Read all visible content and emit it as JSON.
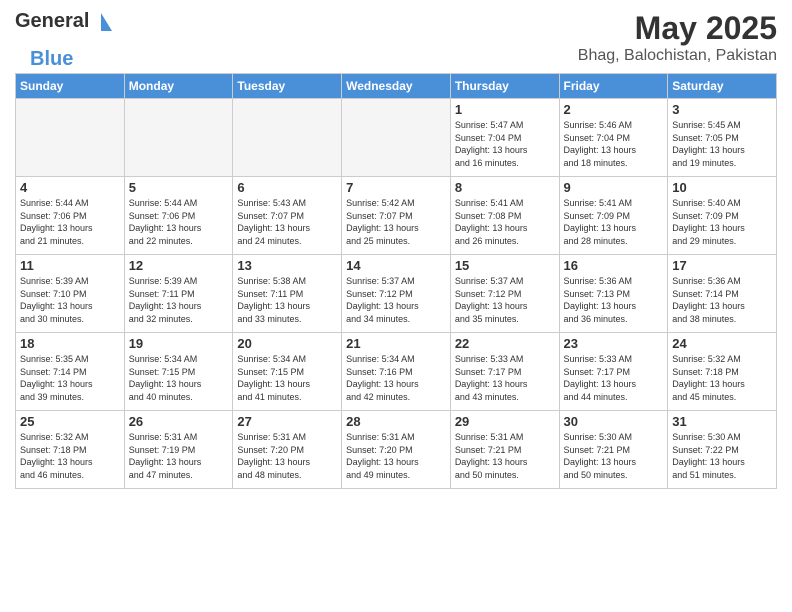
{
  "header": {
    "logo_text_general": "General",
    "logo_text_blue": "Blue",
    "title": "May 2025",
    "subtitle": "Bhag, Balochistan, Pakistan"
  },
  "calendar": {
    "days_of_week": [
      "Sunday",
      "Monday",
      "Tuesday",
      "Wednesday",
      "Thursday",
      "Friday",
      "Saturday"
    ],
    "weeks": [
      [
        {
          "num": "",
          "info": "",
          "empty": true
        },
        {
          "num": "",
          "info": "",
          "empty": true
        },
        {
          "num": "",
          "info": "",
          "empty": true
        },
        {
          "num": "",
          "info": "",
          "empty": true
        },
        {
          "num": "1",
          "info": "Sunrise: 5:47 AM\nSunset: 7:04 PM\nDaylight: 13 hours\nand 16 minutes.",
          "empty": false
        },
        {
          "num": "2",
          "info": "Sunrise: 5:46 AM\nSunset: 7:04 PM\nDaylight: 13 hours\nand 18 minutes.",
          "empty": false
        },
        {
          "num": "3",
          "info": "Sunrise: 5:45 AM\nSunset: 7:05 PM\nDaylight: 13 hours\nand 19 minutes.",
          "empty": false
        }
      ],
      [
        {
          "num": "4",
          "info": "Sunrise: 5:44 AM\nSunset: 7:06 PM\nDaylight: 13 hours\nand 21 minutes.",
          "empty": false
        },
        {
          "num": "5",
          "info": "Sunrise: 5:44 AM\nSunset: 7:06 PM\nDaylight: 13 hours\nand 22 minutes.",
          "empty": false
        },
        {
          "num": "6",
          "info": "Sunrise: 5:43 AM\nSunset: 7:07 PM\nDaylight: 13 hours\nand 24 minutes.",
          "empty": false
        },
        {
          "num": "7",
          "info": "Sunrise: 5:42 AM\nSunset: 7:07 PM\nDaylight: 13 hours\nand 25 minutes.",
          "empty": false
        },
        {
          "num": "8",
          "info": "Sunrise: 5:41 AM\nSunset: 7:08 PM\nDaylight: 13 hours\nand 26 minutes.",
          "empty": false
        },
        {
          "num": "9",
          "info": "Sunrise: 5:41 AM\nSunset: 7:09 PM\nDaylight: 13 hours\nand 28 minutes.",
          "empty": false
        },
        {
          "num": "10",
          "info": "Sunrise: 5:40 AM\nSunset: 7:09 PM\nDaylight: 13 hours\nand 29 minutes.",
          "empty": false
        }
      ],
      [
        {
          "num": "11",
          "info": "Sunrise: 5:39 AM\nSunset: 7:10 PM\nDaylight: 13 hours\nand 30 minutes.",
          "empty": false
        },
        {
          "num": "12",
          "info": "Sunrise: 5:39 AM\nSunset: 7:11 PM\nDaylight: 13 hours\nand 32 minutes.",
          "empty": false
        },
        {
          "num": "13",
          "info": "Sunrise: 5:38 AM\nSunset: 7:11 PM\nDaylight: 13 hours\nand 33 minutes.",
          "empty": false
        },
        {
          "num": "14",
          "info": "Sunrise: 5:37 AM\nSunset: 7:12 PM\nDaylight: 13 hours\nand 34 minutes.",
          "empty": false
        },
        {
          "num": "15",
          "info": "Sunrise: 5:37 AM\nSunset: 7:12 PM\nDaylight: 13 hours\nand 35 minutes.",
          "empty": false
        },
        {
          "num": "16",
          "info": "Sunrise: 5:36 AM\nSunset: 7:13 PM\nDaylight: 13 hours\nand 36 minutes.",
          "empty": false
        },
        {
          "num": "17",
          "info": "Sunrise: 5:36 AM\nSunset: 7:14 PM\nDaylight: 13 hours\nand 38 minutes.",
          "empty": false
        }
      ],
      [
        {
          "num": "18",
          "info": "Sunrise: 5:35 AM\nSunset: 7:14 PM\nDaylight: 13 hours\nand 39 minutes.",
          "empty": false
        },
        {
          "num": "19",
          "info": "Sunrise: 5:34 AM\nSunset: 7:15 PM\nDaylight: 13 hours\nand 40 minutes.",
          "empty": false
        },
        {
          "num": "20",
          "info": "Sunrise: 5:34 AM\nSunset: 7:15 PM\nDaylight: 13 hours\nand 41 minutes.",
          "empty": false
        },
        {
          "num": "21",
          "info": "Sunrise: 5:34 AM\nSunset: 7:16 PM\nDaylight: 13 hours\nand 42 minutes.",
          "empty": false
        },
        {
          "num": "22",
          "info": "Sunrise: 5:33 AM\nSunset: 7:17 PM\nDaylight: 13 hours\nand 43 minutes.",
          "empty": false
        },
        {
          "num": "23",
          "info": "Sunrise: 5:33 AM\nSunset: 7:17 PM\nDaylight: 13 hours\nand 44 minutes.",
          "empty": false
        },
        {
          "num": "24",
          "info": "Sunrise: 5:32 AM\nSunset: 7:18 PM\nDaylight: 13 hours\nand 45 minutes.",
          "empty": false
        }
      ],
      [
        {
          "num": "25",
          "info": "Sunrise: 5:32 AM\nSunset: 7:18 PM\nDaylight: 13 hours\nand 46 minutes.",
          "empty": false
        },
        {
          "num": "26",
          "info": "Sunrise: 5:31 AM\nSunset: 7:19 PM\nDaylight: 13 hours\nand 47 minutes.",
          "empty": false
        },
        {
          "num": "27",
          "info": "Sunrise: 5:31 AM\nSunset: 7:20 PM\nDaylight: 13 hours\nand 48 minutes.",
          "empty": false
        },
        {
          "num": "28",
          "info": "Sunrise: 5:31 AM\nSunset: 7:20 PM\nDaylight: 13 hours\nand 49 minutes.",
          "empty": false
        },
        {
          "num": "29",
          "info": "Sunrise: 5:31 AM\nSunset: 7:21 PM\nDaylight: 13 hours\nand 50 minutes.",
          "empty": false
        },
        {
          "num": "30",
          "info": "Sunrise: 5:30 AM\nSunset: 7:21 PM\nDaylight: 13 hours\nand 50 minutes.",
          "empty": false
        },
        {
          "num": "31",
          "info": "Sunrise: 5:30 AM\nSunset: 7:22 PM\nDaylight: 13 hours\nand 51 minutes.",
          "empty": false
        }
      ]
    ]
  }
}
